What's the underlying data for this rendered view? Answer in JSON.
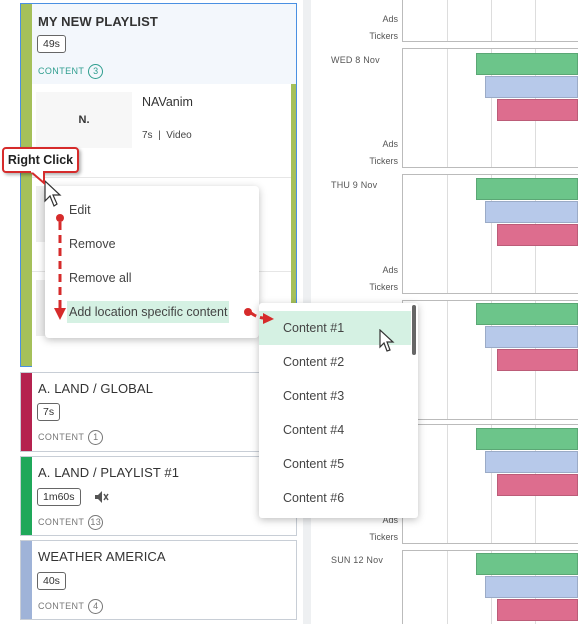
{
  "playlists": [
    {
      "title": "MY NEW PLAYLIST",
      "duration": "49s",
      "content_label": "CONTENT",
      "count": "3",
      "stripe_color": "#a5c05a"
    },
    {
      "title": "A. LAND /  GLOBAL",
      "duration": "7s",
      "content_label": "CONTENT",
      "count": "1",
      "stripe_color": "#b5224f"
    },
    {
      "title": "A. LAND /  PLAYLIST #1",
      "duration": "1m60s",
      "content_label": "CONTENT",
      "count": "13",
      "stripe_color": "#1fa85a",
      "muted_icon": "speaker-muted-icon"
    },
    {
      "title": "WEATHER AMERICA",
      "duration": "40s",
      "content_label": "CONTENT",
      "count": "4",
      "stripe_color": "#9fb3d8"
    }
  ],
  "content_item": {
    "name": "NAVanim",
    "duration": "7s",
    "separator": "|",
    "type": "Video",
    "thumb_text": "N."
  },
  "callout": {
    "label": "Right Click"
  },
  "context_menu": {
    "items": [
      "Edit",
      "Remove",
      "Remove all",
      "Add location specific content"
    ]
  },
  "submenu": {
    "items": [
      "Content #1",
      "Content #2",
      "Content #3",
      "Content #4",
      "Content #5",
      "Content #6"
    ]
  },
  "timeline": {
    "row_labels": {
      "ads": "Ads",
      "tickers": "Tickers"
    },
    "days": [
      "WED 8 Nov",
      "THU 9 Nov",
      "SUN 12 Nov"
    ]
  },
  "colors": {
    "green_bar": "#6cc58a",
    "blue_bar": "#b7c9ea",
    "red_bar": "#dd6d8e",
    "highlight": "#d5f1e3",
    "arrow": "#d62b2b"
  }
}
